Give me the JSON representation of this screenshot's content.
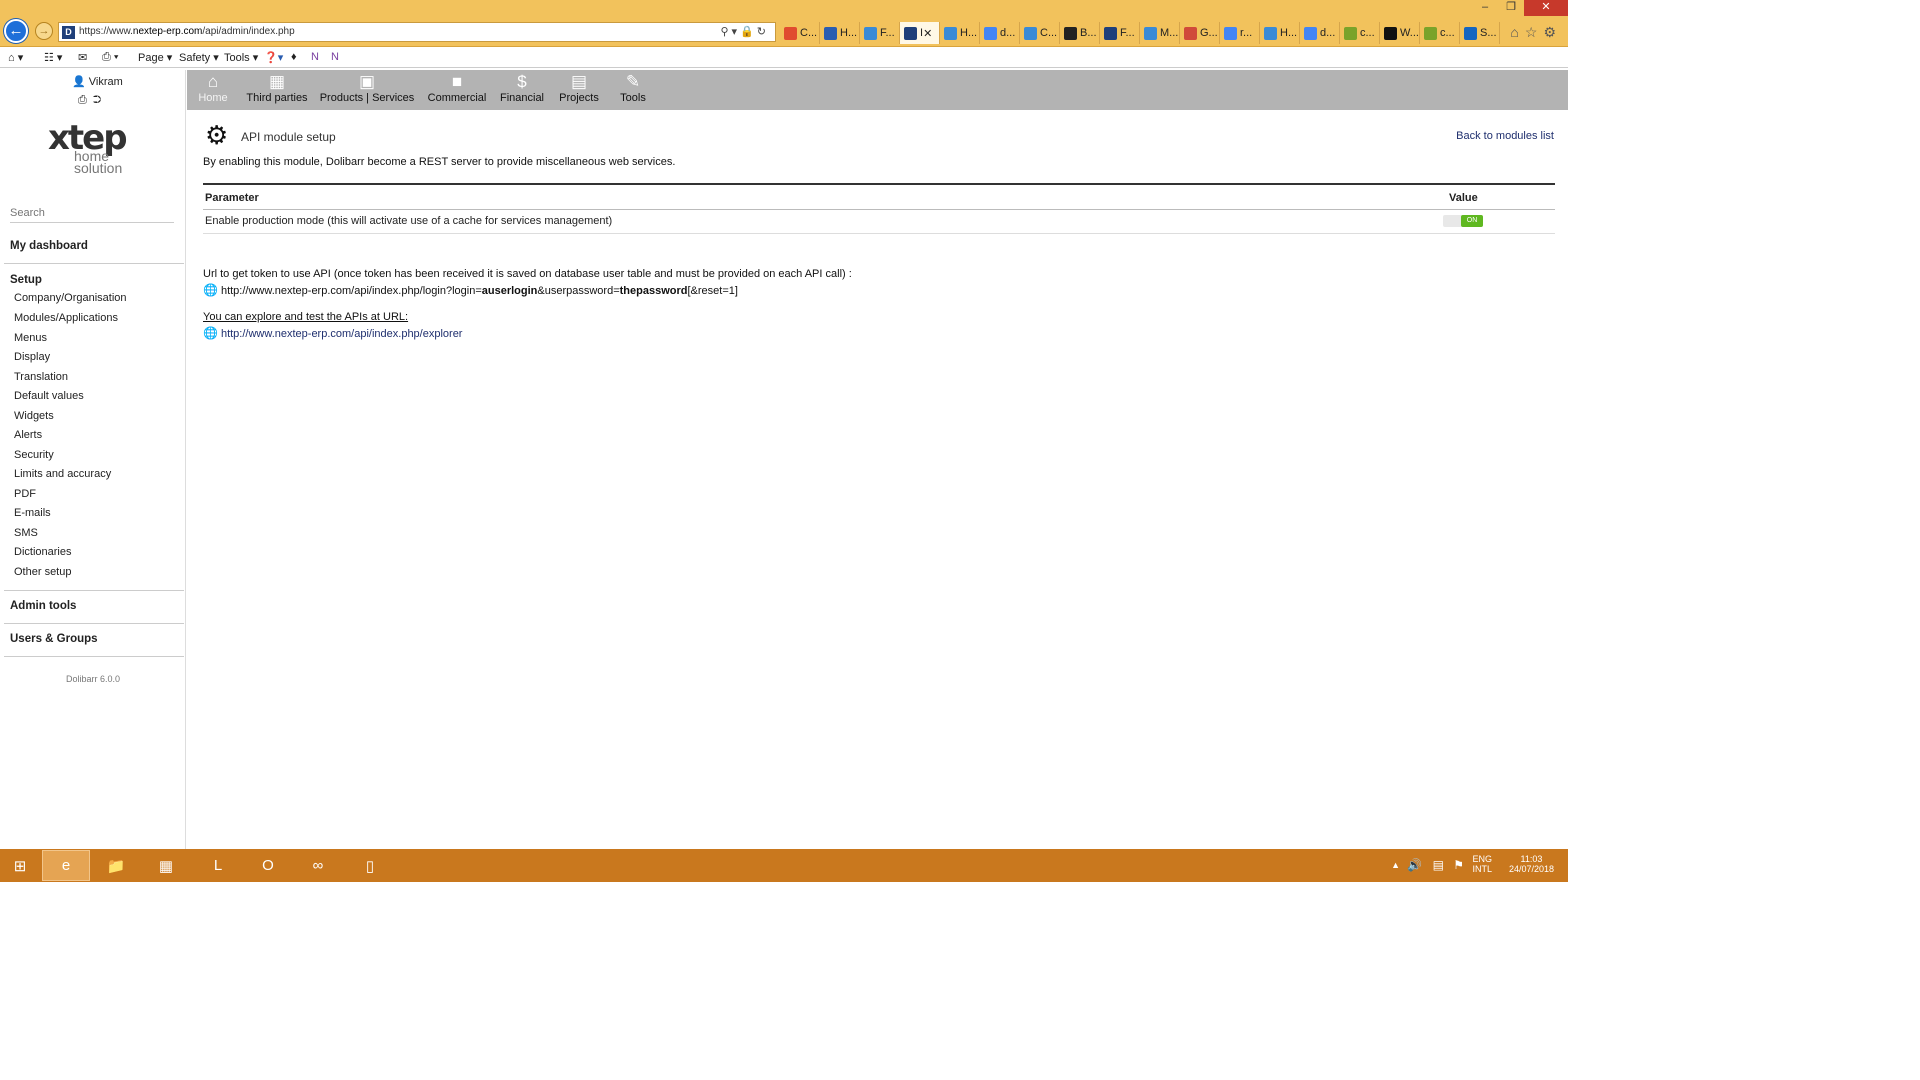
{
  "browser": {
    "url_prefix": "https://www.",
    "url_domain": "nextep-erp.com",
    "url_path": "/api/admin/index.php",
    "tabs": [
      {
        "label": "C...",
        "icon": "windows-icon",
        "color": "#e04b2f"
      },
      {
        "label": "H...",
        "icon": "puzzle-icon",
        "color": "#2a5db0"
      },
      {
        "label": "F...",
        "icon": "ie-icon",
        "color": "#3a8ad6"
      },
      {
        "label": "I",
        "icon": "dolibarr-icon",
        "color": "#1f3f7a"
      },
      {
        "label": "H...",
        "icon": "ie-icon",
        "color": "#3a8ad6"
      },
      {
        "label": "d...",
        "icon": "google-icon",
        "color": "#4285f4"
      },
      {
        "label": "C...",
        "icon": "ie-icon",
        "color": "#3a8ad6"
      },
      {
        "label": "B...",
        "icon": "github-icon",
        "color": "#222222"
      },
      {
        "label": "F...",
        "icon": "dolibarr-icon",
        "color": "#1f3f7a"
      },
      {
        "label": "M...",
        "icon": "ie-icon",
        "color": "#3a8ad6"
      },
      {
        "label": "G...",
        "icon": "doc-icon",
        "color": "#d04a3a"
      },
      {
        "label": "r...",
        "icon": "google-icon",
        "color": "#4285f4"
      },
      {
        "label": "H...",
        "icon": "ie-icon",
        "color": "#3a8ad6"
      },
      {
        "label": "d...",
        "icon": "google-icon",
        "color": "#4285f4"
      },
      {
        "label": "c...",
        "icon": "leaf-icon",
        "color": "#7aa32a"
      },
      {
        "label": "W...",
        "icon": "m-icon",
        "color": "#111111"
      },
      {
        "label": "c...",
        "icon": "leaf-icon",
        "color": "#7aa32a"
      },
      {
        "label": "S...",
        "icon": "b-icon",
        "color": "#1565c0"
      }
    ],
    "command_bar": {
      "page": "Page",
      "safety": "Safety",
      "tools": "Tools"
    }
  },
  "sidebar": {
    "user": "Vikram",
    "logo_text": "xtep",
    "logo_sub1": "home",
    "logo_sub2": "solution",
    "search_placeholder": "Search",
    "dashboard": "My dashboard",
    "setup": "Setup",
    "setup_items": [
      "Company/Organisation",
      "Modules/Applications",
      "Menus",
      "Display",
      "Translation",
      "Default values",
      "Widgets",
      "Alerts",
      "Security",
      "Limits and accuracy",
      "PDF",
      "E-mails",
      "SMS",
      "Dictionaries",
      "Other setup"
    ],
    "admin_tools": "Admin tools",
    "users_groups": "Users & Groups",
    "version": "Dolibarr 6.0.0"
  },
  "topmenu": [
    {
      "label": "Home",
      "icon": "home-icon"
    },
    {
      "label": "Third parties",
      "icon": "building-icon"
    },
    {
      "label": "Products | Services",
      "icon": "box-icon"
    },
    {
      "label": "Commercial",
      "icon": "briefcase-icon"
    },
    {
      "label": "Financial",
      "icon": "dollar-icon"
    },
    {
      "label": "Projects",
      "icon": "clipboard-icon"
    },
    {
      "label": "Tools",
      "icon": "wrench-icon"
    }
  ],
  "content": {
    "title": "API module setup",
    "back_link": "Back to modules list",
    "description": "By enabling this module, Dolibarr become a REST server to provide miscellaneous web services.",
    "table": {
      "col_parameter": "Parameter",
      "col_value": "Value",
      "row_label": "Enable production mode (this will activate use of a cache for services management)",
      "toggle_state": "ON"
    },
    "token_label": "Url to get token to use API (once token has been received it is saved on database user table and must be provided on each API call) :",
    "token_url_1": "http://www.nextep-erp.com/api/index.php/login?login=",
    "token_url_login": "auserlogin",
    "token_url_2": "&userpassword=",
    "token_url_pass": "thepassword",
    "token_url_3": "[&reset=1]",
    "explore_label": "You can explore and test the APIs at URL:",
    "explore_url": "http://www.nextep-erp.com/api/index.php/explorer"
  },
  "taskbar": {
    "lang1": "ENG",
    "lang2": "INTL",
    "time": "11:03",
    "date": "24/07/2018"
  },
  "colors": {
    "titlebar": "#f2c25c",
    "taskbar": "#c9781e",
    "topmenu": "#b3b3b3",
    "link": "#1f2f6e",
    "toggle_on": "#5fb820"
  }
}
